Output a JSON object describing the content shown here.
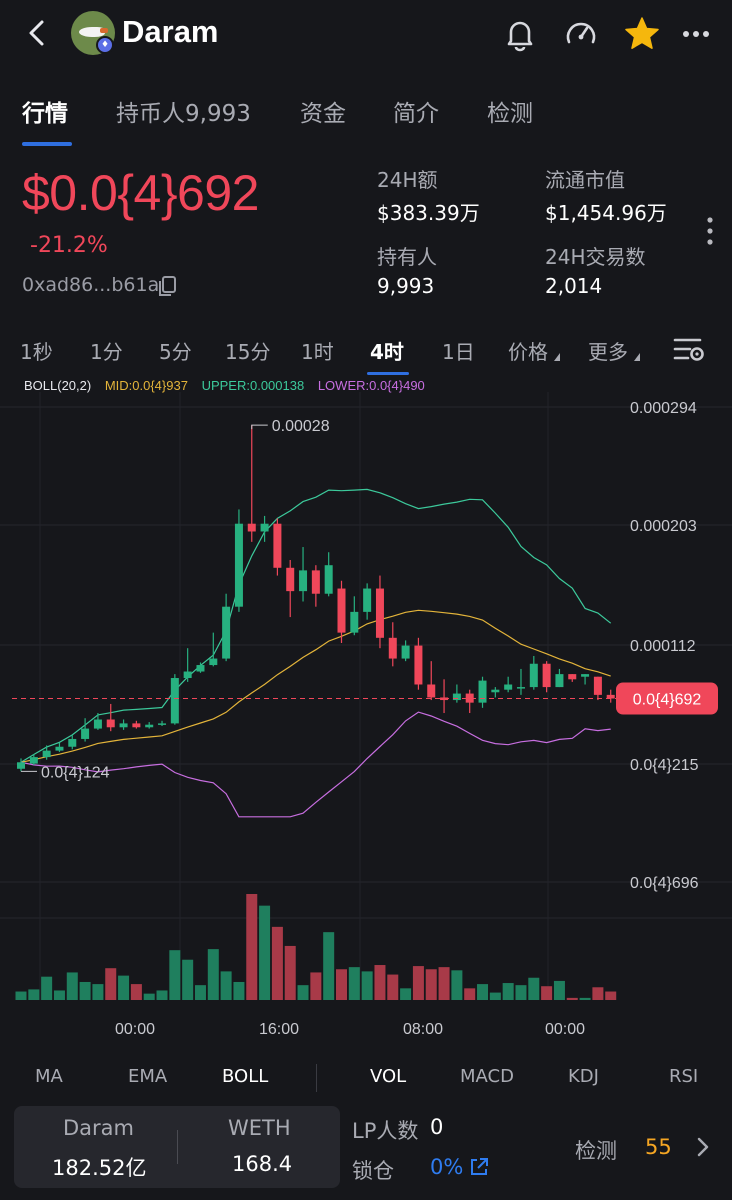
{
  "header": {
    "title": "Daram",
    "icons": [
      "back-icon",
      "token-logo",
      "bell-icon",
      "gauge-icon",
      "star-icon",
      "more-icon"
    ],
    "star_color": "#f5b70d"
  },
  "tabs": [
    {
      "label": "行情",
      "active": true
    },
    {
      "label": "持币人9,993",
      "active": false
    },
    {
      "label": "资金",
      "active": false
    },
    {
      "label": "简介",
      "active": false
    },
    {
      "label": "检测",
      "active": false
    }
  ],
  "price": {
    "value": "$0.0{4}692",
    "change": "-21.2%",
    "address": "0xad86...b61a",
    "color": "#f0475a"
  },
  "stats": {
    "vol24h_label": "24H额",
    "vol24h_value": "$383.39万",
    "mcap_label": "流通市值",
    "mcap_value": "$1,454.96万",
    "holders_label": "持有人",
    "holders_value": "9,993",
    "tx24h_label": "24H交易数",
    "tx24h_value": "2,014"
  },
  "intervals": [
    {
      "label": "1秒",
      "active": false
    },
    {
      "label": "1分",
      "active": false
    },
    {
      "label": "5分",
      "active": false
    },
    {
      "label": "15分",
      "active": false
    },
    {
      "label": "1时",
      "active": false
    },
    {
      "label": "4时",
      "active": true
    },
    {
      "label": "1日",
      "active": false
    },
    {
      "label": "价格",
      "active": false
    },
    {
      "label": "更多",
      "active": false
    }
  ],
  "boll": {
    "params": "BOLL(20,2)",
    "mid": "MID:0.0{4}937",
    "upper": "UPPER:0.000138",
    "lower": "LOWER:0.0{4}490",
    "colors": {
      "mid": "#e3b43a",
      "upper": "#3cc99b",
      "lower": "#c76ee0"
    }
  },
  "chart_data": {
    "type": "candlestick",
    "y_ticks": [
      "0.000294",
      "0.000203",
      "0.000112",
      "0.0{4}215",
      "0.0{4}696"
    ],
    "x_ticks": [
      "00:00",
      "16:00",
      "08:00",
      "00:00"
    ],
    "high_label": "0.00028",
    "low_label": "0.0{4}124",
    "current_label": "0.0{4}692",
    "up_color": "#27b180",
    "down_color": "#f0475a",
    "candles": [
      [
        1.5e-05,
        2e-05,
        2.3e-05,
        1.3e-05
      ],
      [
        1.9e-05,
        2.4e-05,
        2.6e-05,
        1.8e-05
      ],
      [
        2.4e-05,
        2.9e-05,
        3.3e-05,
        2.2e-05
      ],
      [
        2.9e-05,
        3.2e-05,
        3.5e-05,
        2.8e-05
      ],
      [
        3.2e-05,
        3.8e-05,
        4.1e-05,
        3e-05
      ],
      [
        3.8e-05,
        4.6e-05,
        5.4e-05,
        3.6e-05
      ],
      [
        4.6e-05,
        5.3e-05,
        5.8e-05,
        4.5e-05
      ],
      [
        5.3e-05,
        4.7e-05,
        6.5e-05,
        4.4e-05
      ],
      [
        4.7e-05,
        5e-05,
        5.3e-05,
        4.5e-05
      ],
      [
        5e-05,
        4.7e-05,
        5.2e-05,
        4.6e-05
      ],
      [
        4.7e-05,
        4.9e-05,
        5.1e-05,
        4.6e-05
      ],
      [
        4.9e-05,
        5e-05,
        5.2e-05,
        4.8e-05
      ],
      [
        5e-05,
        8.5e-05,
        8.8e-05,
        4.9e-05
      ],
      [
        8.5e-05,
        9e-05,
        0.000108,
        8.2e-05
      ],
      [
        9e-05,
        9.5e-05,
        9.7e-05,
        8.9e-05
      ],
      [
        9.5e-05,
        0.0001,
        0.00012,
        9.4e-05
      ],
      [
        0.0001,
        0.00014,
        0.00015,
        9.8e-05
      ],
      [
        0.00014,
        0.000204,
        0.000215,
        0.000136
      ],
      [
        0.000204,
        0.000198,
        0.00028,
        0.00019
      ],
      [
        0.000198,
        0.000204,
        0.00021,
        0.00019
      ],
      [
        0.000204,
        0.00017,
        0.000208,
        0.000164
      ],
      [
        0.00017,
        0.000152,
        0.000176,
        0.000132
      ],
      [
        0.000152,
        0.000168,
        0.000186,
        0.000144
      ],
      [
        0.000168,
        0.00015,
        0.000172,
        0.00014
      ],
      [
        0.00015,
        0.000172,
        0.000182,
        0.000148
      ],
      [
        0.000154,
        0.00012,
        0.00016,
        0.000112
      ],
      [
        0.00012,
        0.000136,
        0.000148,
        0.000118
      ],
      [
        0.000136,
        0.000154,
        0.000158,
        0.00013
      ],
      [
        0.000154,
        0.000116,
        0.000164,
        0.000108
      ],
      [
        0.000116,
        0.0001,
        0.000128,
        9.4e-05
      ],
      [
        0.0001,
        0.00011,
        0.000114,
        9.8e-05
      ],
      [
        0.00011,
        8e-05,
        0.000116,
        7.6e-05
      ],
      [
        8e-05,
        7e-05,
        9.8e-05,
        6.8e-05
      ],
      [
        7e-05,
        6.8e-05,
        8.4e-05,
        5.8e-05
      ],
      [
        6.8e-05,
        7.3e-05,
        8e-05,
        6.6e-05
      ],
      [
        7.3e-05,
        6.6e-05,
        7.6e-05,
        5.8e-05
      ],
      [
        6.6e-05,
        8.3e-05,
        8.6e-05,
        6.2e-05
      ],
      [
        7.4e-05,
        7.6e-05,
        7.8e-05,
        7e-05
      ],
      [
        7.6e-05,
        8e-05,
        8.6e-05,
        7.4e-05
      ],
      [
        7.8e-05,
        7.8e-05,
        9.2e-05,
        7.2e-05
      ],
      [
        7.8e-05,
        9.6e-05,
        0.000102,
        7.6e-05
      ],
      [
        9.6e-05,
        7.8e-05,
        9.8e-05,
        7.4e-05
      ],
      [
        7.8e-05,
        8.8e-05,
        9.2e-05,
        7.8e-05
      ],
      [
        8.8e-05,
        8.4e-05,
        8.8e-05,
        8.2e-05
      ],
      [
        8.6e-05,
        8.8e-05,
        8.8e-05,
        8e-05
      ],
      [
        8.6e-05,
        7.2e-05,
        8.6e-05,
        6.8e-05
      ],
      [
        7.2e-05,
        6.92e-05,
        7.6e-05,
        6.6e-05
      ]
    ],
    "volumes": [
      0.08,
      0.1,
      0.22,
      0.09,
      0.26,
      0.17,
      0.15,
      0.3,
      0.23,
      0.15,
      0.06,
      0.09,
      0.47,
      0.38,
      0.14,
      0.48,
      0.27,
      0.17,
      1.0,
      0.89,
      0.69,
      0.51,
      0.14,
      0.26,
      0.64,
      0.29,
      0.31,
      0.27,
      0.33,
      0.24,
      0.11,
      0.32,
      0.29,
      0.31,
      0.28,
      0.11,
      0.15,
      0.07,
      0.16,
      0.14,
      0.21,
      0.13,
      0.18,
      0.02,
      0.02,
      0.12,
      0.08
    ]
  },
  "indicators": [
    {
      "label": "MA",
      "active": false
    },
    {
      "label": "EMA",
      "active": false
    },
    {
      "label": "BOLL",
      "active": true
    },
    {
      "label": "VOL",
      "active": true
    },
    {
      "label": "MACD",
      "active": false
    },
    {
      "label": "KDJ",
      "active": false
    },
    {
      "label": "RSI",
      "active": false
    }
  ],
  "pool": {
    "token_a_label": "Daram",
    "token_a_value": "182.52亿",
    "token_b_label": "WETH",
    "token_b_value": "168.4"
  },
  "lp": {
    "holders_label": "LP人数",
    "holders_value": "0",
    "lock_label": "锁仓",
    "lock_value": "0%"
  },
  "check": {
    "label": "检测",
    "score": "55",
    "score_color": "#f5a623"
  }
}
